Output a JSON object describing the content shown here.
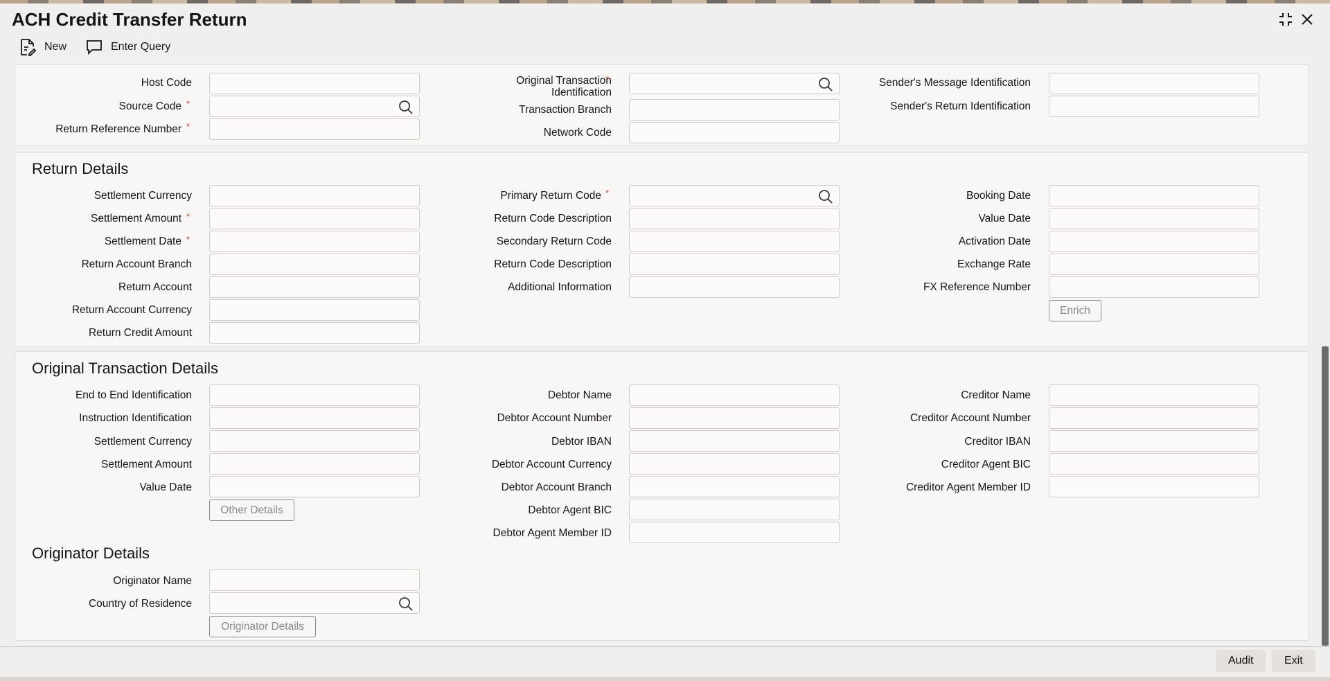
{
  "window": {
    "title": "ACH Credit Transfer Return"
  },
  "toolbar": {
    "new_label": "New",
    "enter_query_label": "Enter Query"
  },
  "header_fields": {
    "host_code": "Host Code",
    "source_code": "Source Code",
    "return_reference_number": "Return Reference Number",
    "original_transaction_identification_1": "Original Transaction",
    "original_transaction_identification_2": "Identification",
    "transaction_branch": "Transaction Branch",
    "network_code": "Network Code",
    "senders_message_identification": "Sender's Message Identification",
    "senders_return_identification": "Sender's Return Identification",
    "required_mark": "*"
  },
  "return_details": {
    "title": "Return Details",
    "settlement_currency": "Settlement Currency",
    "settlement_amount": "Settlement Amount",
    "settlement_date": "Settlement Date",
    "return_account_branch": "Return Account Branch",
    "return_account": "Return Account",
    "return_account_currency": "Return Account Currency",
    "return_credit_amount": "Return Credit Amount",
    "primary_return_code": "Primary Return Code",
    "return_code_description": "Return Code Description",
    "secondary_return_code": "Secondary Return Code",
    "return_code_description_2": "Return Code Description",
    "additional_information": "Additional Information",
    "booking_date": "Booking Date",
    "value_date": "Value Date",
    "activation_date": "Activation Date",
    "exchange_rate": "Exchange Rate",
    "fx_reference_number": "FX Reference Number",
    "enrich_label": "Enrich"
  },
  "original_transaction_details": {
    "title": "Original Transaction Details",
    "end_to_end_identification": "End to End Identification",
    "instruction_identification": "Instruction Identification",
    "settlement_currency": "Settlement Currency",
    "settlement_amount": "Settlement Amount",
    "value_date": "Value Date",
    "other_details_label": "Other Details",
    "debtor_name": "Debtor Name",
    "debtor_account_number": "Debtor Account Number",
    "debtor_iban": "Debtor IBAN",
    "debtor_account_currency": "Debtor Account Currency",
    "debtor_account_branch": "Debtor Account Branch",
    "debtor_agent_bic": "Debtor Agent BIC",
    "debtor_agent_member_id": "Debtor Agent Member ID",
    "creditor_name": "Creditor Name",
    "creditor_account_number": "Creditor Account Number",
    "creditor_iban": "Creditor IBAN",
    "creditor_agent_bic": "Creditor Agent BIC",
    "creditor_agent_member_id": "Creditor Agent Member ID"
  },
  "originator_details": {
    "title": "Originator Details",
    "originator_name": "Originator Name",
    "country_of_residence": "Country of Residence",
    "originator_details_label": "Originator Details"
  },
  "footer": {
    "audit_label": "Audit",
    "exit_label": "Exit"
  },
  "icons": {
    "new": "document-edit-icon",
    "enter_query": "chat-bubble-icon",
    "search": "search-icon",
    "maximize": "maximize-icon",
    "close": "close-icon"
  }
}
